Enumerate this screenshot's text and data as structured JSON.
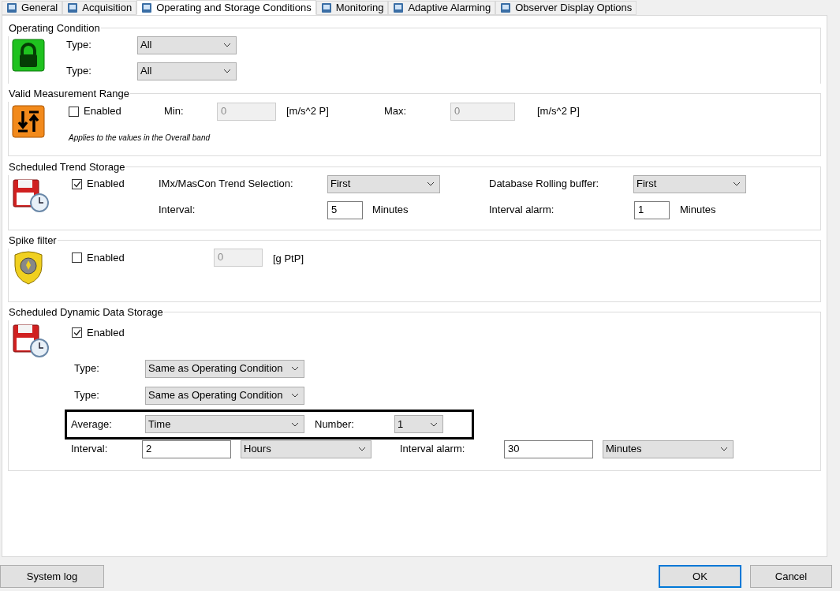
{
  "tabs": [
    {
      "label": "General",
      "selected": false
    },
    {
      "label": "Acquisition",
      "selected": false
    },
    {
      "label": "Operating and Storage Conditions",
      "selected": true
    },
    {
      "label": "Monitoring",
      "selected": false
    },
    {
      "label": "Adaptive Alarming",
      "selected": false
    },
    {
      "label": "Observer Display Options",
      "selected": false
    }
  ],
  "operating_condition": {
    "title": "Operating Condition",
    "types": [
      {
        "label": "Type:",
        "value": "All"
      },
      {
        "label": "Type:",
        "value": "All"
      }
    ]
  },
  "valid_measurement_range": {
    "title": "Valid Measurement Range",
    "enabled": {
      "label": "Enabled",
      "checked": false
    },
    "min": {
      "label": "Min:",
      "value": "0",
      "unit": "[m/s^2 P]",
      "disabled": true
    },
    "max": {
      "label": "Max:",
      "value": "0",
      "unit": "[m/s^2 P]",
      "disabled": true
    },
    "note": "Applies to the values in the Overall band"
  },
  "scheduled_trend_storage": {
    "title": "Scheduled Trend Storage",
    "enabled": {
      "label": "Enabled",
      "checked": true
    },
    "trend_selection": {
      "label": "IMx/MasCon Trend Selection:",
      "value": "First"
    },
    "rolling_buffer": {
      "label": "Database Rolling buffer:",
      "value": "First"
    },
    "interval": {
      "label": "Interval:",
      "value": "5",
      "unit": "Minutes"
    },
    "interval_alarm": {
      "label": "Interval alarm:",
      "value": "1",
      "unit": "Minutes"
    }
  },
  "spike_filter": {
    "title": "Spike filter",
    "enabled": {
      "label": "Enabled",
      "checked": false
    },
    "value": "0",
    "disabled": true,
    "unit": "[g PtP]"
  },
  "scheduled_dynamic_data_storage": {
    "title": "Scheduled Dynamic Data Storage",
    "enabled": {
      "label": "Enabled",
      "checked": true
    },
    "types": [
      {
        "label": "Type:",
        "value": "Same as Operating Condition"
      },
      {
        "label": "Type:",
        "value": "Same as Operating Condition"
      }
    ],
    "average": {
      "label": "Average:",
      "value": "Time"
    },
    "number": {
      "label": "Number:",
      "value": "1"
    },
    "interval": {
      "label": "Interval:",
      "value": "2",
      "unit": "Hours"
    },
    "interval_alarm": {
      "label": "Interval alarm:",
      "value": "30",
      "unit": "Minutes"
    }
  },
  "buttons": {
    "system_log": "System log",
    "ok": {
      "label": "OK",
      "default": true
    },
    "cancel": "Cancel"
  }
}
